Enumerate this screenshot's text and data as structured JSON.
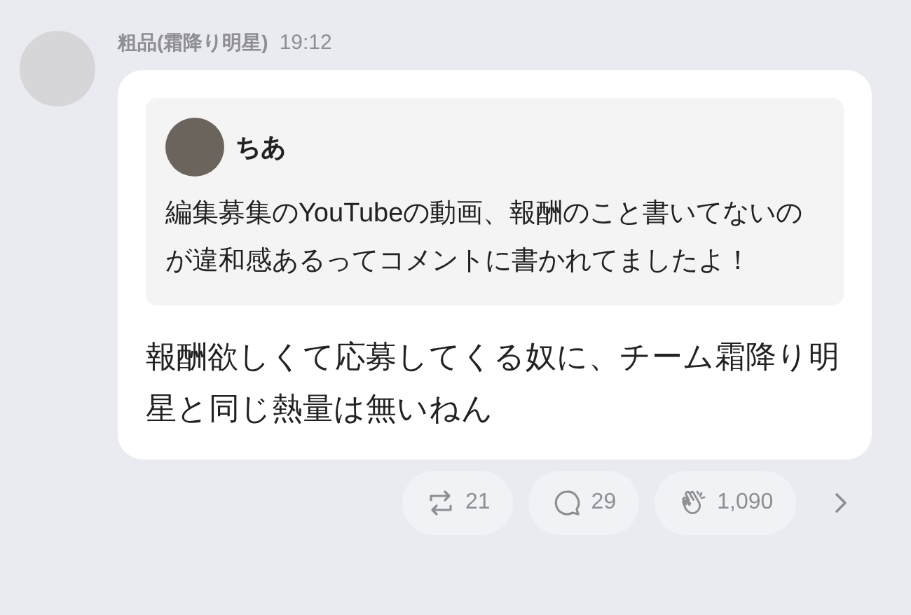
{
  "post": {
    "author": "粗品(霜降り明星)",
    "time": "19:12",
    "quote": {
      "author": "ちあ",
      "text": "編集募集のYouTubeの動画、報酬のこと書いてないのが違和感あるってコメントに書かれてましたよ！"
    },
    "text": "報酬欲しくて応募してくる奴に、チーム霜降り明星と同じ熱量は無いねん"
  },
  "actions": [
    {
      "kind": "repost",
      "count": "21"
    },
    {
      "kind": "comment",
      "count": "29"
    },
    {
      "kind": "clap",
      "count": "1,090"
    }
  ]
}
